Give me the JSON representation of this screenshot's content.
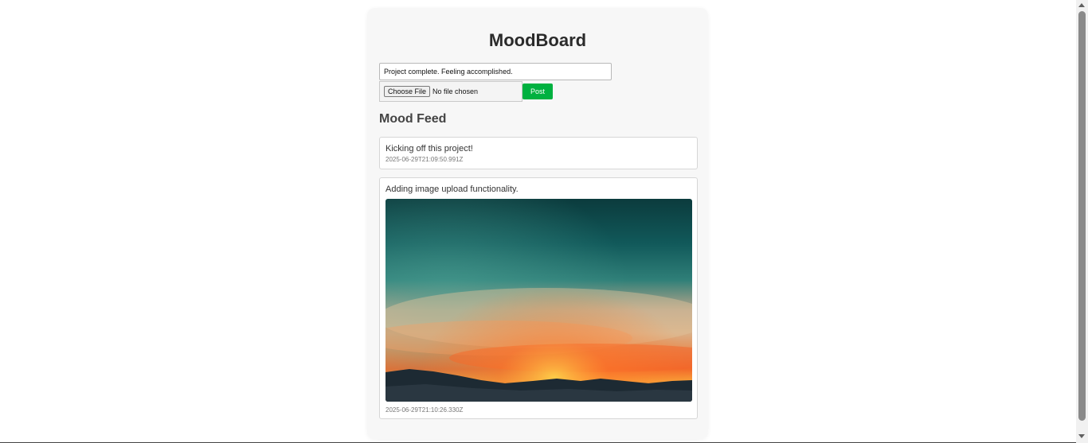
{
  "app": {
    "title": "MoodBoard"
  },
  "composer": {
    "mood_value": "Project complete. Feeling accomplished.",
    "choose_file_label": "Choose File",
    "no_file_label": "No file chosen",
    "post_label": "Post"
  },
  "feed": {
    "heading": "Mood Feed",
    "posts": [
      {
        "text": "Kicking off this project!",
        "timestamp": "2025-06-29T21:09:50.991Z"
      },
      {
        "text": "Adding image upload functionality.",
        "timestamp": "2025-06-29T21:10:26.330Z",
        "image": "sunset-landscape-photo"
      }
    ]
  },
  "colors": {
    "accent": "#00b140",
    "card_bg": "#f7f7f7"
  }
}
